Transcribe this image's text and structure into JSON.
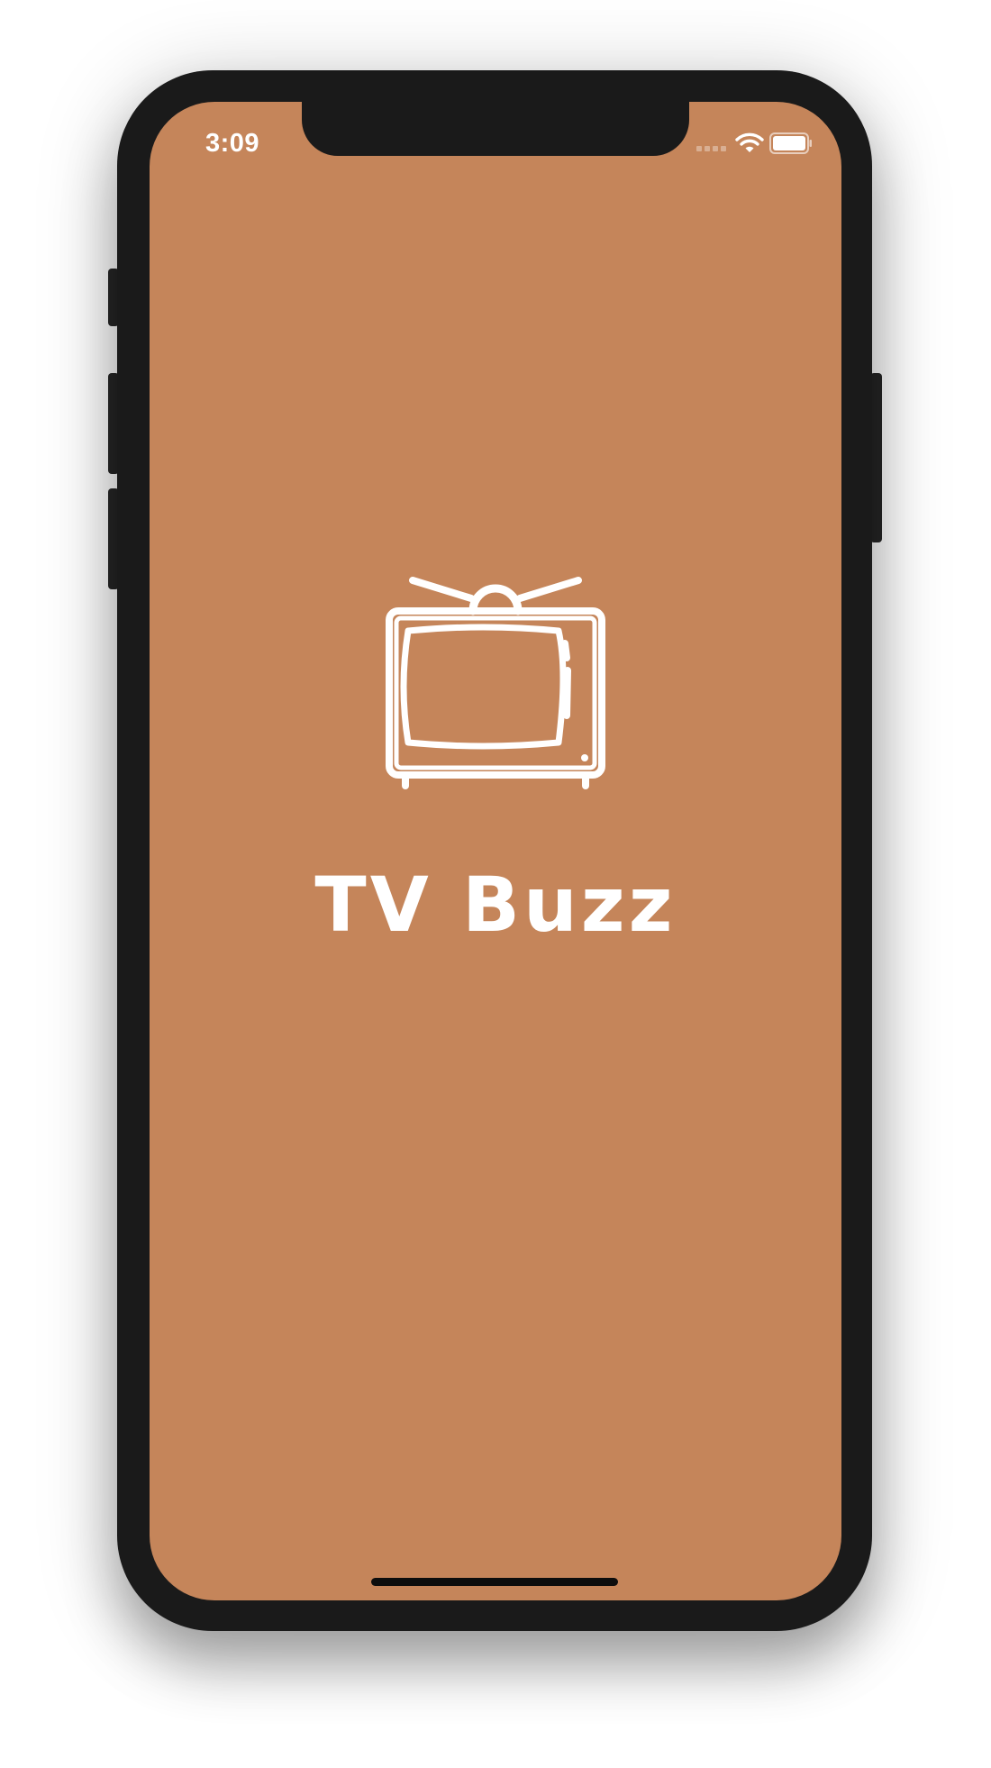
{
  "status_bar": {
    "time": "3:09",
    "signal_icon": "cellular-signal-icon",
    "wifi_icon": "wifi-icon",
    "battery_icon": "battery-icon"
  },
  "splash": {
    "logo_icon": "tv-icon",
    "app_title": "TV Buzz"
  },
  "colors": {
    "background": "#c5855a",
    "foreground": "#ffffff",
    "device_frame": "#1a1a1a"
  }
}
